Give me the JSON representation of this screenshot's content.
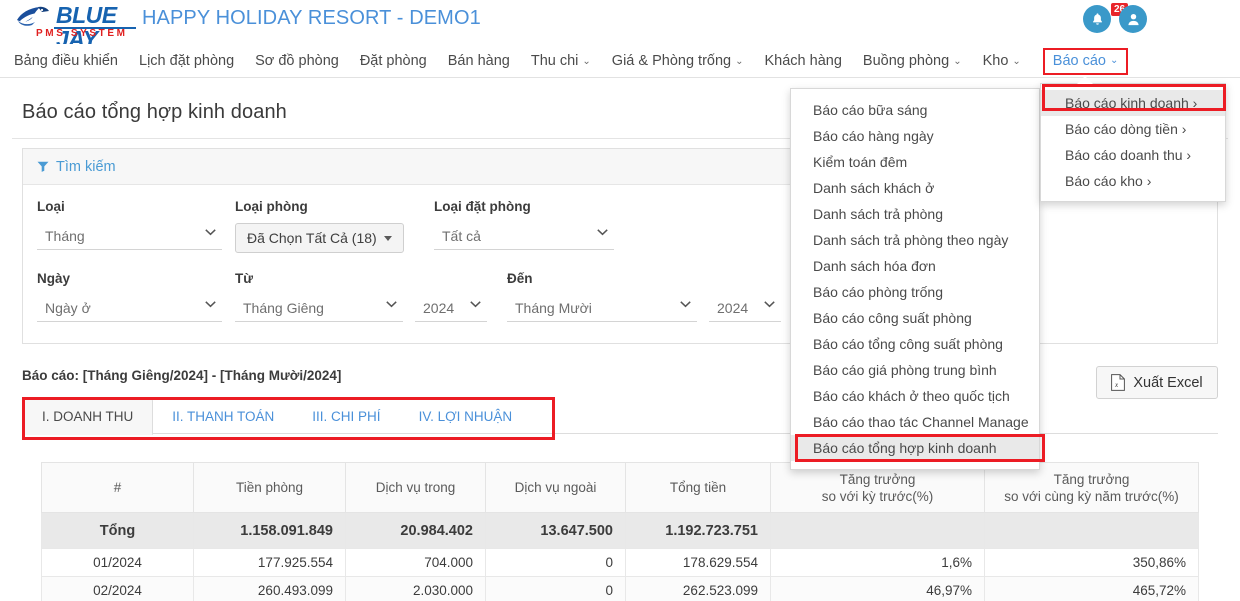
{
  "header": {
    "logo_word": "BLUE JAY",
    "logo_sub": "PMS SYSTEM",
    "site_title": "HAPPY HOLIDAY RESORT - DEMO1",
    "notification_count": "26",
    "bell_icon": "bell-icon",
    "user_icon": "user-avatar-icon"
  },
  "nav": {
    "items": [
      {
        "label": "Bảng điều khiển",
        "caret": ""
      },
      {
        "label": "Lịch đặt phòng",
        "caret": ""
      },
      {
        "label": "Sơ đồ phòng",
        "caret": ""
      },
      {
        "label": "Đặt phòng",
        "caret": ""
      },
      {
        "label": "Bán hàng",
        "caret": ""
      },
      {
        "label": "Thu chi",
        "caret": "⌄"
      },
      {
        "label": "Giá & Phòng trống",
        "caret": "⌄"
      },
      {
        "label": "Khách hàng",
        "caret": ""
      },
      {
        "label": "Buồng phòng",
        "caret": "⌄"
      },
      {
        "label": "Kho",
        "caret": "⌄"
      }
    ],
    "active": {
      "label": "Báo cáo",
      "caret": "⌄"
    },
    "highlight_color": "#ec1c24"
  },
  "menu": {
    "items": [
      "Báo cáo bữa sáng",
      "Báo cáo hàng ngày",
      "Kiểm toán đêm",
      "Danh sách khách ở",
      "Danh sách trả phòng",
      "Danh sách trả phòng theo ngày",
      "Danh sách hóa đơn",
      "Báo cáo phòng trống",
      "Báo cáo công suất phòng",
      "Báo cáo tổng công suất phòng",
      "Báo cáo giá phòng trung bình",
      "Báo cáo khách ở theo quốc tịch",
      "Báo cáo thao tác Channel Manage",
      "Báo cáo tổng hợp kinh doanh"
    ],
    "selected": "Báo cáo tổng hợp kinh doanh",
    "submenu": [
      "Báo cáo kinh doanh ›",
      "Báo cáo dòng tiền ›",
      "Báo cáo doanh thu ›",
      "Báo cáo kho ›"
    ],
    "submenu_selected": "Báo cáo kinh doanh ›"
  },
  "page": {
    "title": "Báo cáo tổng hợp kinh doanh",
    "search_label": "Tìm kiếm",
    "report_line": "Báo cáo: [Tháng Giêng/2024] - [Tháng Mười/2024]",
    "export_label": "Xuất Excel",
    "export_icon": "excel-file-icon"
  },
  "filters": {
    "loai": {
      "label": "Loại",
      "value": "Tháng"
    },
    "loai_phong": {
      "label": "Loại phòng",
      "value": "Đã Chọn Tất Cả (18)"
    },
    "loai_dat_phong": {
      "label": "Loại đặt phòng",
      "value": "Tất cả"
    },
    "ngay": {
      "label": "Ngày",
      "value": "Ngày ở"
    },
    "tu": {
      "label": "Từ",
      "month": "Tháng Giêng",
      "year": "2024"
    },
    "den": {
      "label": "Đến",
      "month": "Tháng Mười",
      "year": "2024"
    }
  },
  "tabs": {
    "items": [
      "I. DOANH THU",
      "II. THANH TOÁN",
      "III. CHI PHÍ",
      "IV. LỢI NHUẬN"
    ],
    "active": "I. DOANH THU"
  },
  "table": {
    "headers": [
      "#",
      "Tiền phòng",
      "Dịch vụ trong",
      "Dịch vụ ngoài",
      "Tổng tiền",
      "Tăng trưởng\nso với kỳ trước(%)",
      "Tăng trưởng\nso với cùng kỳ năm trước(%)"
    ],
    "headers_line1": [
      "#",
      "Tiền phòng",
      "Dịch vụ trong",
      "Dịch vụ ngoài",
      "Tổng tiền",
      "Tăng trưởng",
      "Tăng trưởng"
    ],
    "headers_line2": [
      "",
      "",
      "",
      "",
      "",
      "so với kỳ trước(%)",
      "so với cùng kỳ năm trước(%)"
    ],
    "rows": [
      {
        "label": "Tổng",
        "tien_phong": "1.158.091.849",
        "dich_vu_trong": "20.984.402",
        "dich_vu_ngoai": "13.647.500",
        "tong_tien": "1.192.723.751",
        "tang_truong_ky_truoc": "",
        "tang_truong_nam_truoc": "",
        "is_total": true
      },
      {
        "label": "01/2024",
        "tien_phong": "177.925.554",
        "dich_vu_trong": "704.000",
        "dich_vu_ngoai": "0",
        "tong_tien": "178.629.554",
        "tang_truong_ky_truoc": "1,6%",
        "tang_truong_nam_truoc": "350,86%",
        "is_total": false
      },
      {
        "label": "02/2024",
        "tien_phong": "260.493.099",
        "dich_vu_trong": "2.030.000",
        "dich_vu_ngoai": "0",
        "tong_tien": "262.523.099",
        "tang_truong_ky_truoc": "46,97%",
        "tang_truong_nam_truoc": "465,72%",
        "is_total": false
      }
    ]
  }
}
